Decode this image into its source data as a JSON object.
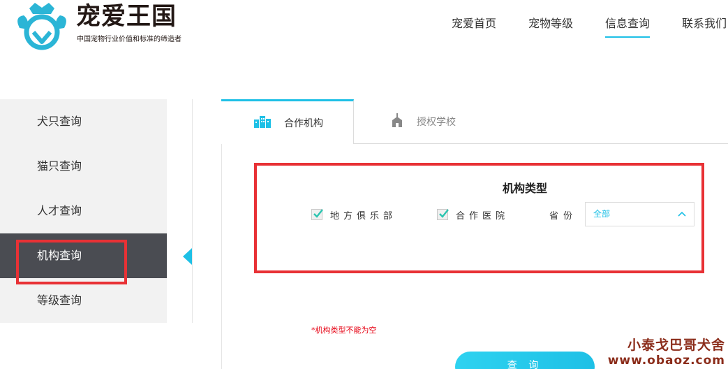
{
  "header": {
    "logo_title": "宠爱王国",
    "logo_subtitle": "中国宠物行业价值和标准的缔造者",
    "nav": [
      "宠爱首页",
      "宠物等级",
      "信息查询",
      "联系我们"
    ],
    "active_nav": "信息查询"
  },
  "sidebar": {
    "items": [
      {
        "label": "犬只查询"
      },
      {
        "label": "猫只查询"
      },
      {
        "label": "人才查询"
      },
      {
        "label": "机构查询"
      },
      {
        "label": "等级查询"
      }
    ],
    "active": "机构查询"
  },
  "tabs": [
    {
      "label": "合作机构",
      "icon": "buildings-icon",
      "active": true
    },
    {
      "label": "授权学校",
      "icon": "school-icon",
      "active": false
    }
  ],
  "filter": {
    "title": "机构类型",
    "options": [
      {
        "label": "地方俱乐部",
        "checked": true
      },
      {
        "label": "合作医院",
        "checked": true
      }
    ],
    "province_label": "省份",
    "province_value": "全部"
  },
  "warning": "*机构类型不能为空",
  "query_button": "查 询",
  "watermark": {
    "line1": "小泰戈巴哥犬舍",
    "line2": "www.obaoz.com"
  },
  "colors": {
    "accent": "#1ec0e6",
    "highlight_frame": "#e83135",
    "sidebar_active": "#4a4c52",
    "warning": "#e60012"
  }
}
